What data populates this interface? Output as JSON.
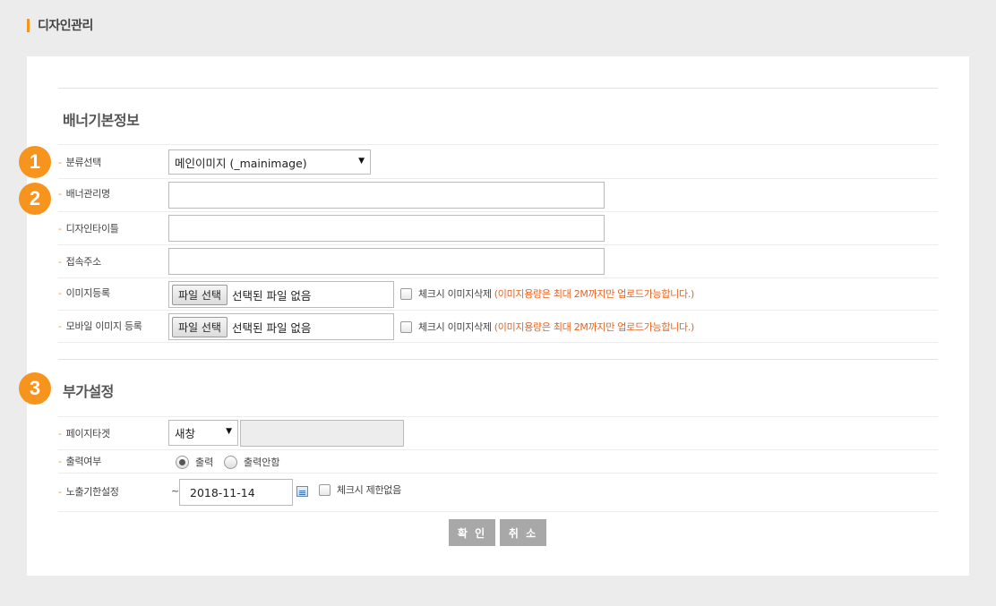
{
  "page": {
    "title": "디자인관리"
  },
  "sections": {
    "basic": {
      "title": "배너기본정보"
    },
    "extra": {
      "title": "부가설정"
    }
  },
  "badges": [
    "1",
    "2",
    "3"
  ],
  "fields": {
    "category": {
      "label": "분류선택",
      "value": "메인이미지 (_mainimage)"
    },
    "banner_name": {
      "label": "배너관리명",
      "value": ""
    },
    "design_title": {
      "label": "디자인타이틀",
      "value": ""
    },
    "url": {
      "label": "접속주소",
      "value": ""
    },
    "image": {
      "label": "이미지등록",
      "file_button": "파일 선택",
      "file_status": "선택된 파일 없음",
      "checkbox_label": "체크시 이미지삭제",
      "note": "(이미지용량은 최대 2M까지만 업로드가능합니다.)"
    },
    "mobile_image": {
      "label": "모바일 이미지 등록",
      "file_button": "파일 선택",
      "file_status": "선택된 파일 없음",
      "checkbox_label": "체크시 이미지삭제",
      "note": "(이미지용량은 최대 2M까지만 업로드가능합니다.)"
    },
    "page_target": {
      "label": "페이지타겟",
      "value": "새창"
    },
    "output": {
      "label": "출력여부",
      "options": [
        "출력",
        "출력안함"
      ],
      "selected": "출력"
    },
    "expiry": {
      "label": "노출기한설정",
      "tilde": "~",
      "date": "2018-11-14",
      "checkbox_label": "체크시 제한없음"
    }
  },
  "buttons": {
    "confirm": "확 인",
    "cancel": "취 소"
  },
  "colors": {
    "accent": "#f7941d",
    "note": "#e8631e",
    "button": "#a8a8a8"
  },
  "icons": {
    "calendar": "calendar-icon",
    "dropdown": "chevron-down-icon"
  }
}
